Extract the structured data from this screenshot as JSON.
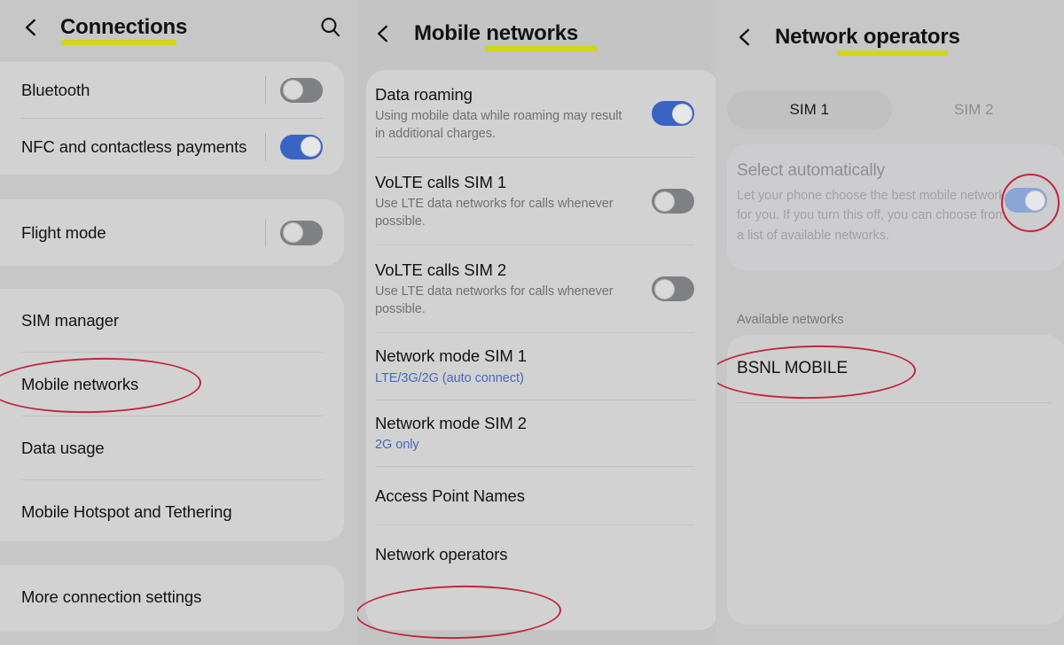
{
  "panels": [
    {
      "id": "connections",
      "header": {
        "title": "Connections",
        "back_icon": "chevron-left-icon",
        "search_icon": "search-icon"
      },
      "groups": [
        {
          "rows": [
            {
              "title": "Bluetooth",
              "toggle": "off"
            },
            {
              "title": "NFC and contactless payments",
              "toggle": "on"
            }
          ]
        },
        {
          "rows": [
            {
              "title": "Flight mode",
              "toggle": "off"
            }
          ]
        },
        {
          "rows": [
            {
              "title": "SIM manager"
            },
            {
              "title": "Mobile networks",
              "annotated": true
            },
            {
              "title": "Data usage"
            },
            {
              "title": "Mobile Hotspot and Tethering"
            }
          ]
        },
        {
          "rows": [
            {
              "title": "More connection settings"
            }
          ]
        }
      ]
    },
    {
      "id": "mobile-networks",
      "header": {
        "title": "Mobile networks",
        "back_icon": "chevron-left-icon"
      },
      "groups": [
        {
          "rows": [
            {
              "title": "Data roaming",
              "subtitle": "Using mobile data while roaming may result in additional charges.",
              "toggle": "on"
            },
            {
              "title": "VoLTE calls SIM 1",
              "subtitle": "Use LTE data networks for calls whenever possible.",
              "toggle": "off"
            },
            {
              "title": "VoLTE calls SIM 2",
              "subtitle": "Use LTE data networks for calls whenever possible.",
              "toggle": "off"
            },
            {
              "title": "Network mode SIM 1",
              "subtitle": "LTE/3G/2G (auto connect)",
              "subtitle_style": "link"
            },
            {
              "title": "Network mode SIM 2",
              "subtitle": "2G only",
              "subtitle_style": "link"
            },
            {
              "title": "Access Point Names"
            },
            {
              "title": "Network operators",
              "annotated": true
            }
          ]
        }
      ]
    },
    {
      "id": "network-operators",
      "header": {
        "title": "Network operators",
        "back_icon": "chevron-left-icon"
      },
      "tabs": [
        {
          "label": "SIM 1",
          "active": true
        },
        {
          "label": "SIM 2",
          "active": false
        }
      ],
      "select_automatically": {
        "title": "Select automatically",
        "subtitle": "Let your phone choose the best mobile network for you. If you turn this off, you can choose from a list of available networks.",
        "toggle": "on",
        "dimmed": true,
        "annotated": true
      },
      "available_networks": {
        "label": "Available networks",
        "items": [
          {
            "name": "BSNL MOBILE",
            "annotated": true
          }
        ]
      }
    }
  ],
  "colors": {
    "page_background": "#c7c7c8",
    "card_background": "#d2d2d3",
    "accent_toggle_on": "#3a64c4",
    "accent_toggle_on_faded": "#8ba5d6",
    "toggle_off": "#7f8084",
    "highlight_underline": "#d2d616",
    "link_text": "#4868b8",
    "annotation_ellipse": "#c0273c"
  }
}
